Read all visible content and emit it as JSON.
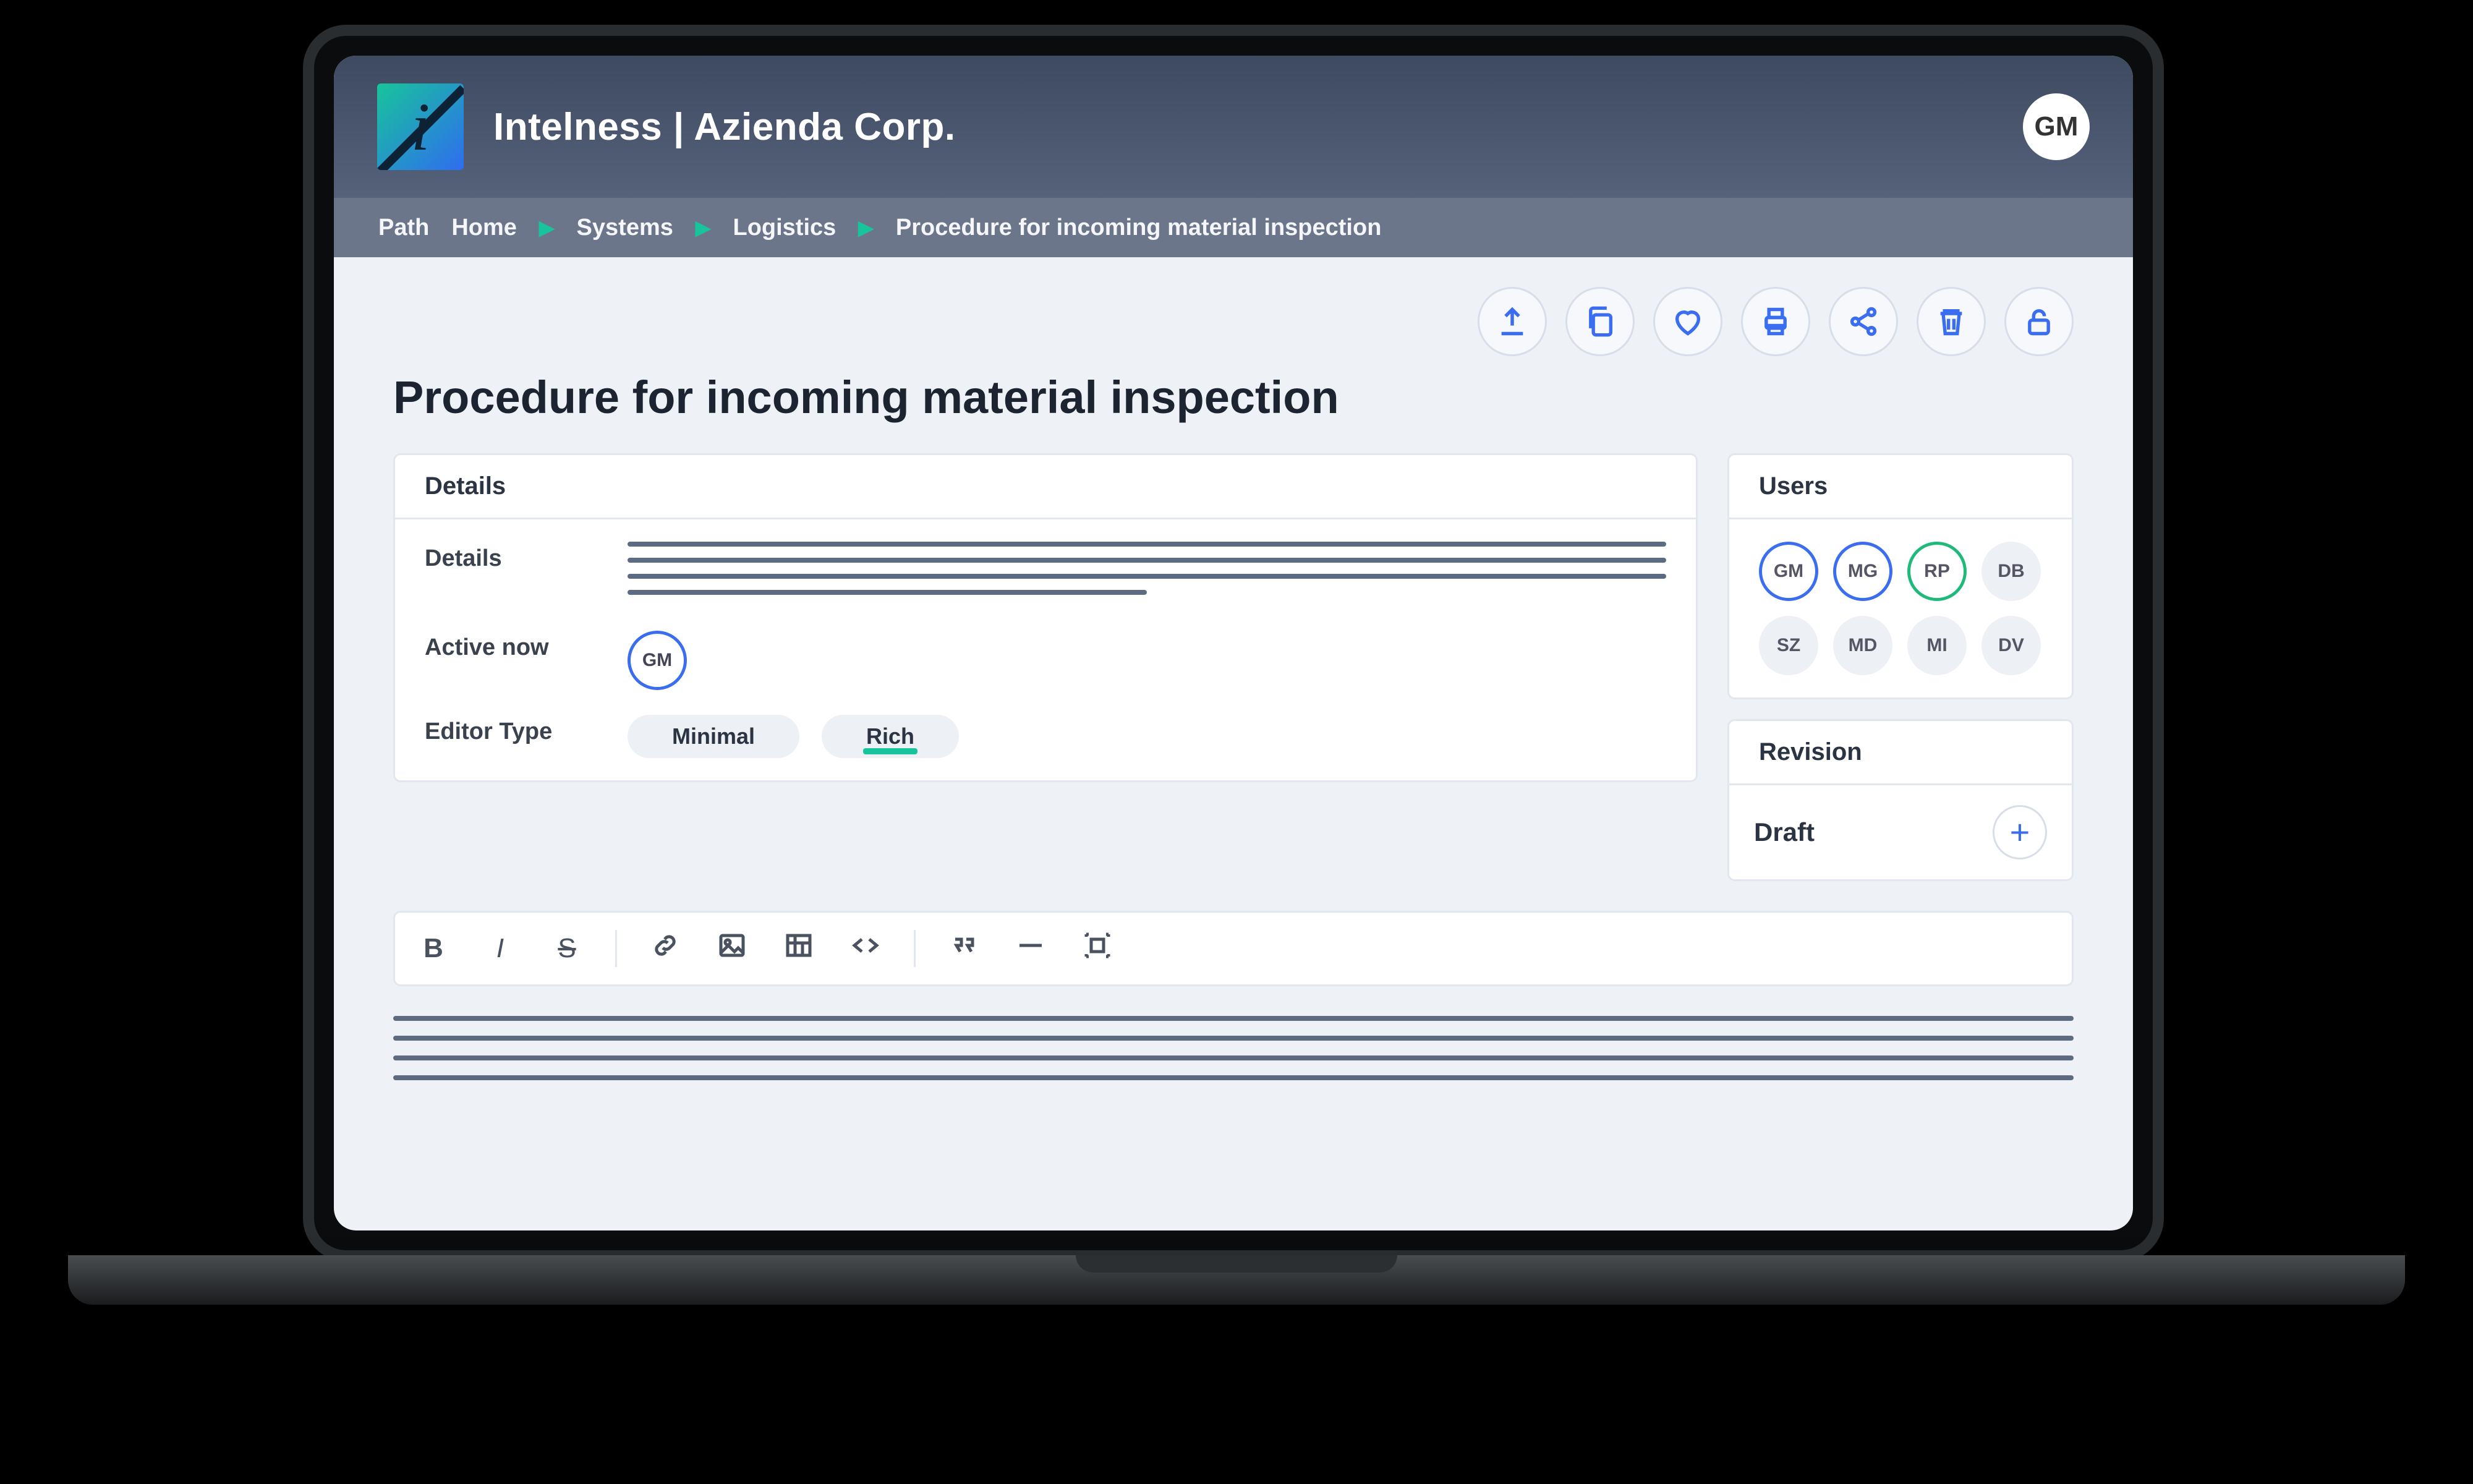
{
  "brand": {
    "app_title": "Intelness | Azienda Corp.",
    "logo_letter": "i"
  },
  "current_user": {
    "initials": "GM"
  },
  "breadcrumb": {
    "label": "Path",
    "items": [
      "Home",
      "Systems",
      "Logistics",
      "Procedure for incoming material inspection"
    ]
  },
  "page": {
    "title": "Procedure for incoming material inspection"
  },
  "action_icons": [
    "export-icon",
    "copy-icon",
    "heart-icon",
    "print-icon",
    "share-icon",
    "trash-icon",
    "unlock-icon"
  ],
  "details_card": {
    "title": "Details",
    "rows": {
      "details_label": "Details",
      "active_now_label": "Active now",
      "active_now_user": "GM",
      "editor_type_label": "Editor Type",
      "editor_type_options": [
        "Minimal",
        "Rich"
      ],
      "editor_type_selected": "Rich"
    }
  },
  "users_card": {
    "title": "Users",
    "users": [
      {
        "initials": "GM",
        "ring": "blue"
      },
      {
        "initials": "MG",
        "ring": "blue"
      },
      {
        "initials": "RP",
        "ring": "green"
      },
      {
        "initials": "DB",
        "ring": "none"
      },
      {
        "initials": "SZ",
        "ring": "none"
      },
      {
        "initials": "MD",
        "ring": "none"
      },
      {
        "initials": "MI",
        "ring": "none"
      },
      {
        "initials": "DV",
        "ring": "none"
      }
    ]
  },
  "revision_card": {
    "title": "Revision",
    "status": "Draft"
  },
  "toolbar_icons": [
    "bold",
    "italic",
    "strike",
    "|",
    "link",
    "image",
    "table",
    "code",
    "|",
    "quote",
    "hr",
    "select-all"
  ]
}
